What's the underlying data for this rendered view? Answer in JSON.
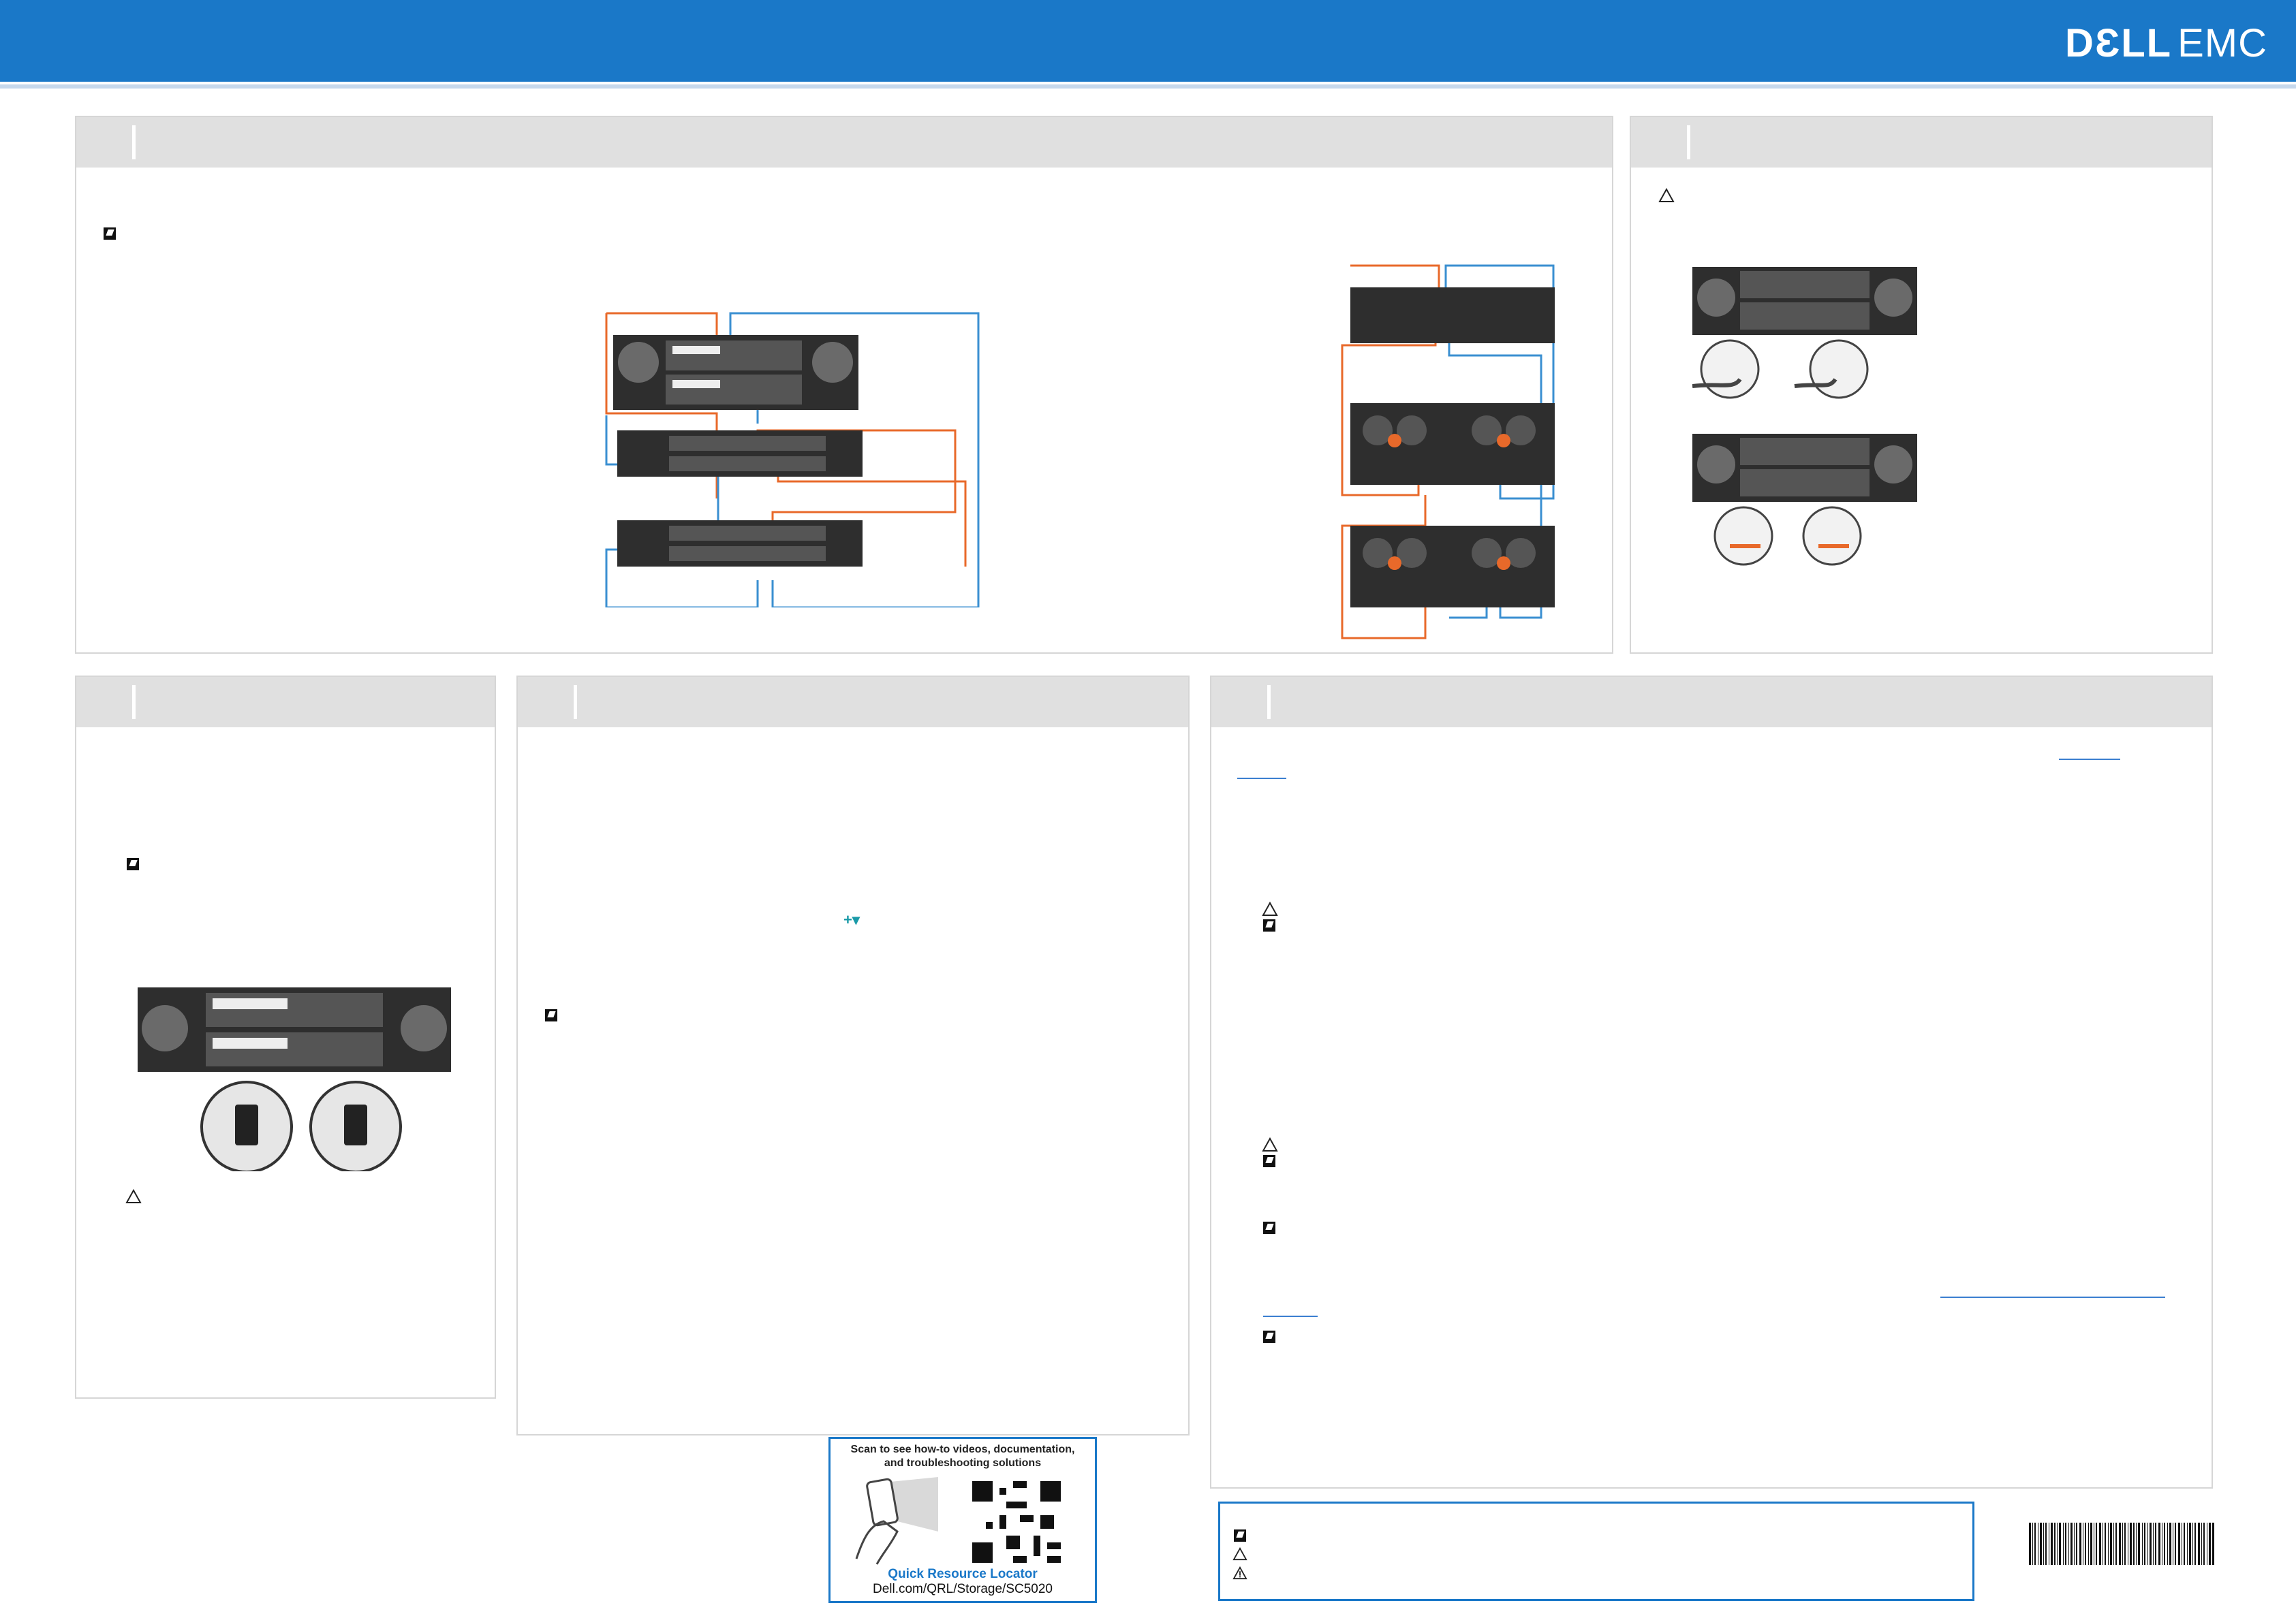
{
  "header": {
    "logo_dell": "DƐLL",
    "logo_emc": "EMC"
  },
  "colors": {
    "header_blue": "#1a78c8",
    "cable_orange": "#e8692a",
    "cable_blue": "#3a8fd1"
  },
  "qr": {
    "title_line1": "Scan to see how-to videos, documentation,",
    "title_line2": "and troubleshooting solutions",
    "label": "Quick Resource Locator",
    "url": "Dell.com/QRL/Storage/SC5020"
  },
  "icons": {
    "note": "note-icon",
    "caution": "caution-triangle-icon",
    "warning": "warning-triangle-icon",
    "expand": "+▾"
  }
}
